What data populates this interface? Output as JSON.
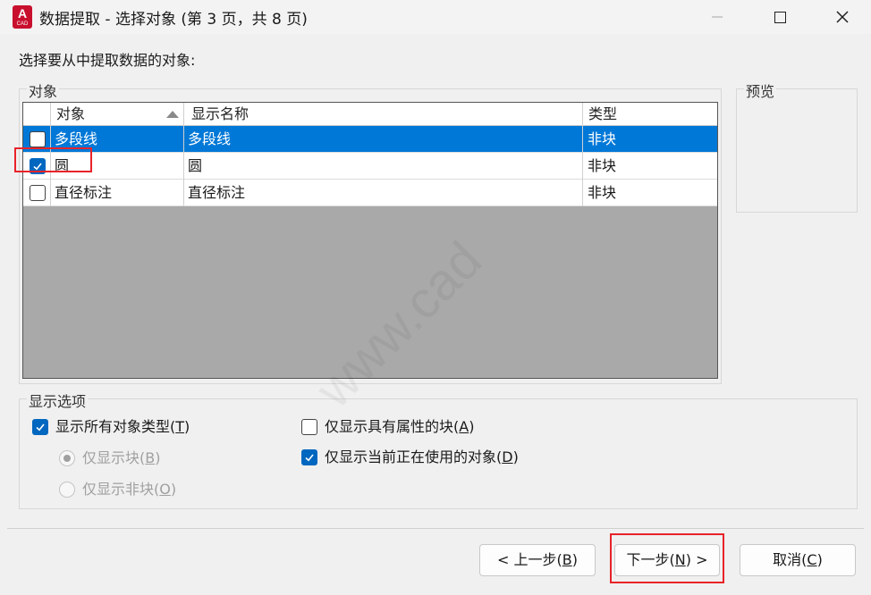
{
  "window": {
    "title": "数据提取 - 选择对象 (第 3 页，共 8 页)",
    "app_logo_text": "A",
    "app_logo_subtext": "CAD",
    "controls": [
      "minimize-icon",
      "maximize-icon",
      "close-icon"
    ]
  },
  "prompt": "选择要从中提取数据的对象:",
  "objects_group": {
    "legend": "对象",
    "columns": [
      "对象",
      "显示名称",
      "类型"
    ],
    "sort": {
      "column": "对象",
      "direction": "ascending"
    },
    "rows": [
      {
        "object": "多段线",
        "display_name": "多段线",
        "type": "非块",
        "checked": false,
        "selected": true
      },
      {
        "object": "圆",
        "display_name": "圆",
        "type": "非块",
        "checked": true,
        "selected": false
      },
      {
        "object": "直径标注",
        "display_name": "直径标注",
        "type": "非块",
        "checked": false,
        "selected": false
      }
    ]
  },
  "preview_group": {
    "legend": "预览"
  },
  "display_options": {
    "legend": "显示选项",
    "show_all_types": {
      "label": "显示所有对象类型(",
      "key": "T",
      "suffix": ")",
      "checked": true
    },
    "blocks_only": {
      "label": "仅显示块(",
      "key": "B",
      "suffix": ")",
      "selected": true,
      "enabled": false
    },
    "non_blocks_only": {
      "label": "仅显示非块(",
      "key": "O",
      "suffix": ")",
      "selected": false,
      "enabled": false
    },
    "blocks_with_attributes": {
      "label": "仅显示具有属性的块(",
      "key": "A",
      "suffix": ")",
      "checked": false
    },
    "objects_in_use": {
      "label": "仅显示当前正在使用的对象(",
      "key": "D",
      "suffix": ")",
      "checked": true
    }
  },
  "buttons": {
    "back": {
      "label": "< 上一步(",
      "key": "B",
      "suffix": ")"
    },
    "next": {
      "label": "下一步(",
      "key": "N",
      "suffix": ") >"
    },
    "cancel": {
      "label": "取消(",
      "key": "C",
      "suffix": ")"
    }
  },
  "watermark": "www.cad"
}
